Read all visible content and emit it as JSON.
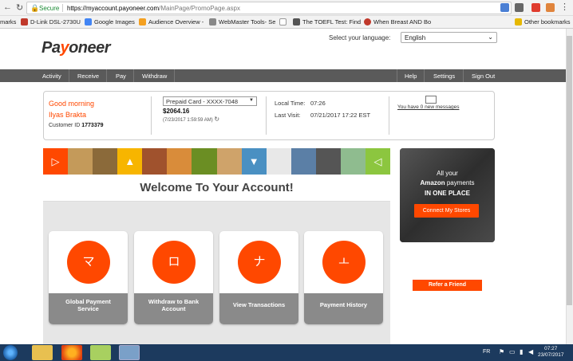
{
  "browser": {
    "secure_label": "Secure",
    "url_host": "https://myaccount.payoneer.com",
    "url_path": "/MainPage/PromoPage.aspx",
    "bookmarks": [
      {
        "label": "marks",
        "color": "#ffffff"
      },
      {
        "label": "D-Link DSL-2730U",
        "color": "#c0392b"
      },
      {
        "label": "Google Images",
        "color": "#4285f4"
      },
      {
        "label": "Audience Overview -",
        "color": "#f4a020"
      },
      {
        "label": "WebMaster Tools- Se",
        "color": "#888888"
      },
      {
        "label": "",
        "color": "#999999"
      },
      {
        "label": "The TOEFL Test: Find",
        "color": "#555555"
      },
      {
        "label": "When Breast AND Bo",
        "color": "#c0392b"
      },
      {
        "label": "Other bookmarks",
        "color": "#e6b800"
      }
    ]
  },
  "header": {
    "logo_pre": "Pa",
    "logo_o": "y",
    "logo_post": "oneer",
    "lang_label": "Select your language:",
    "lang_value": "English"
  },
  "nav": {
    "left": [
      "Activity",
      "Receive",
      "Pay",
      "Withdraw"
    ],
    "right": [
      "Help",
      "Settings",
      "Sign Out"
    ]
  },
  "account": {
    "greeting": "Good morning",
    "name": "Ilyas Brakta",
    "customer_id_label": "Customer ID",
    "customer_id": "1773379",
    "card": "Prepaid Card - XXXX-7048",
    "balance": "$2064.16",
    "balance_time": "(7/23/2017 1:59:59 AM)",
    "local_time_label": "Local Time:",
    "local_time": "07:26",
    "last_visit_label": "Last Visit:",
    "last_visit": "07/21/2017 17:22 EST",
    "messages": "You have 0 new messages"
  },
  "welcome": {
    "title": "Welcome To Your Account!"
  },
  "banner_colors": [
    "#ff4800",
    "#c49a5a",
    "#8b6a3a",
    "#f7b500",
    "#a0522d",
    "#d98c3a",
    "#6b8e23",
    "#cfa36a",
    "#4a90c2",
    "#e8e8e8",
    "#5b7fa6",
    "#555555",
    "#8fbc8f",
    "#8cc63f"
  ],
  "actions": [
    {
      "glyph": "マ",
      "label_1": "Global Payment",
      "label_2": "Service"
    },
    {
      "glyph": "ロ",
      "label_1": "Withdraw to Bank",
      "label_2": "Account"
    },
    {
      "glyph": "ナ",
      "label_1": "View Transactions",
      "label_2": ""
    },
    {
      "glyph": "ㅗ",
      "label_1": "Payment History",
      "label_2": ""
    }
  ],
  "amazon_ad": {
    "line1": "All your",
    "line2_strong": "Amazon",
    "line2_rest": " payments",
    "line3": "IN ONE PLACE",
    "button": "Connect My Stores"
  },
  "refer": "Refer a Friend",
  "taskbar": {
    "lang": "FR",
    "time": "07:27",
    "date": "23/07/2017"
  }
}
